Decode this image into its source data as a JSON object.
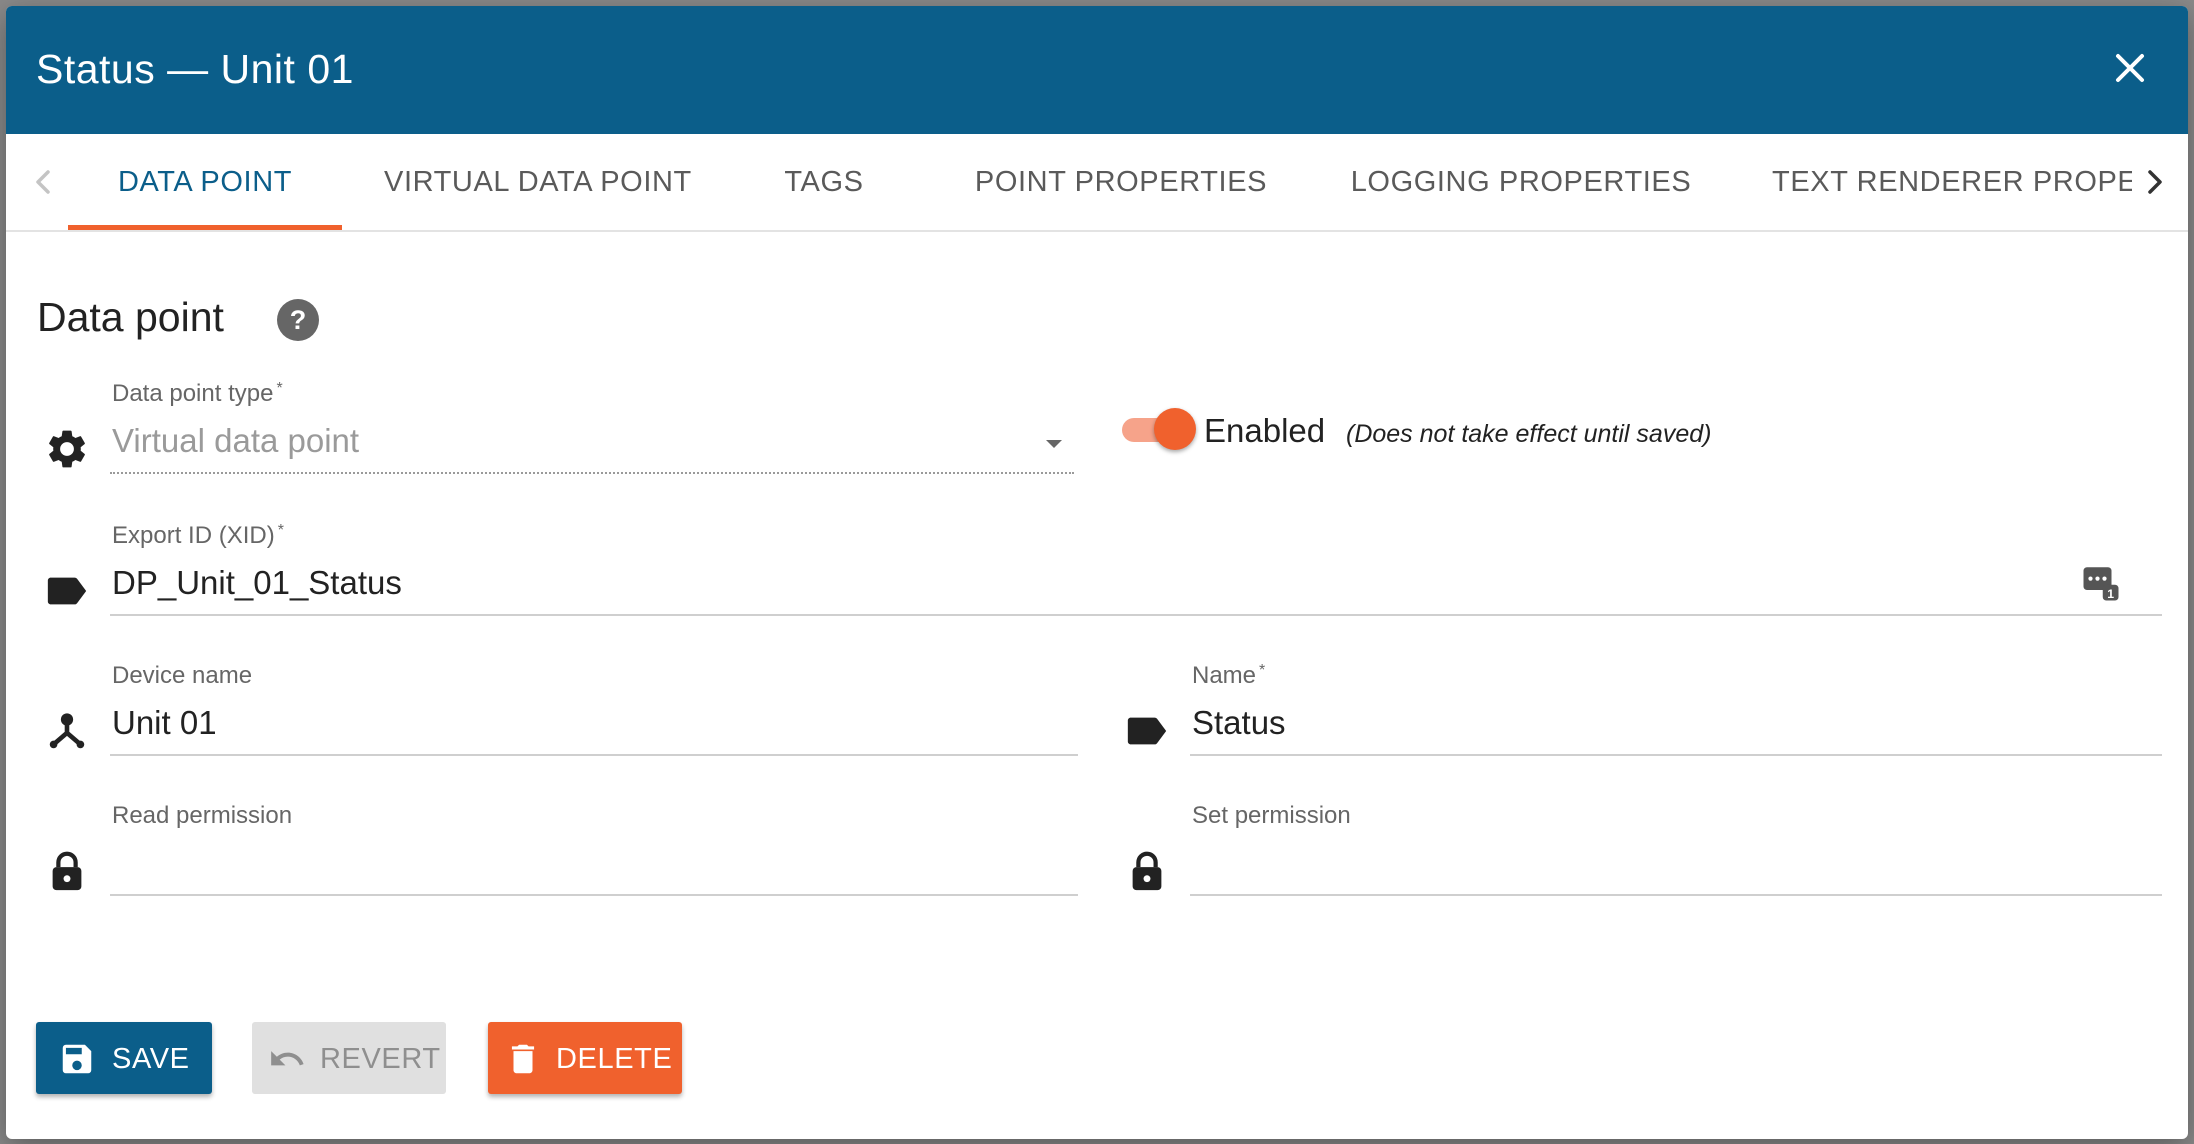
{
  "dialog": {
    "title": "Status — Unit 01"
  },
  "tabs": [
    {
      "label": "DATA POINT",
      "active": true
    },
    {
      "label": "VIRTUAL DATA POINT"
    },
    {
      "label": "TAGS"
    },
    {
      "label": "POINT PROPERTIES"
    },
    {
      "label": "LOGGING PROPERTIES"
    },
    {
      "label": "TEXT RENDERER PROPEI"
    }
  ],
  "section": {
    "title": "Data point"
  },
  "fields": {
    "data_point_type": {
      "label": "Data point type",
      "required": "*",
      "value": "Virtual data point"
    },
    "enabled": {
      "label": "Enabled",
      "note": "(Does not take effect until saved)",
      "checked": true
    },
    "export_id": {
      "label": "Export ID (XID)",
      "required": "*",
      "value": "DP_Unit_01_Status"
    },
    "device_name": {
      "label": "Device name",
      "value": "Unit 01"
    },
    "name": {
      "label": "Name",
      "required": "*",
      "value": "Status"
    },
    "read_permission": {
      "label": "Read permission",
      "value": ""
    },
    "set_permission": {
      "label": "Set permission",
      "value": ""
    }
  },
  "buttons": {
    "save": "SAVE",
    "revert": "REVERT",
    "delete": "DELETE"
  },
  "colors": {
    "header": "#0b5e8a",
    "accent": "#f0612d",
    "tab_active": "#0b5e8a"
  },
  "icons": [
    "close-icon",
    "chevron-left-icon",
    "chevron-right-icon",
    "help-icon",
    "gear-icon",
    "tag-icon",
    "generate-id-icon",
    "device-icon",
    "lock-icon",
    "save-icon",
    "undo-icon",
    "trash-icon"
  ]
}
